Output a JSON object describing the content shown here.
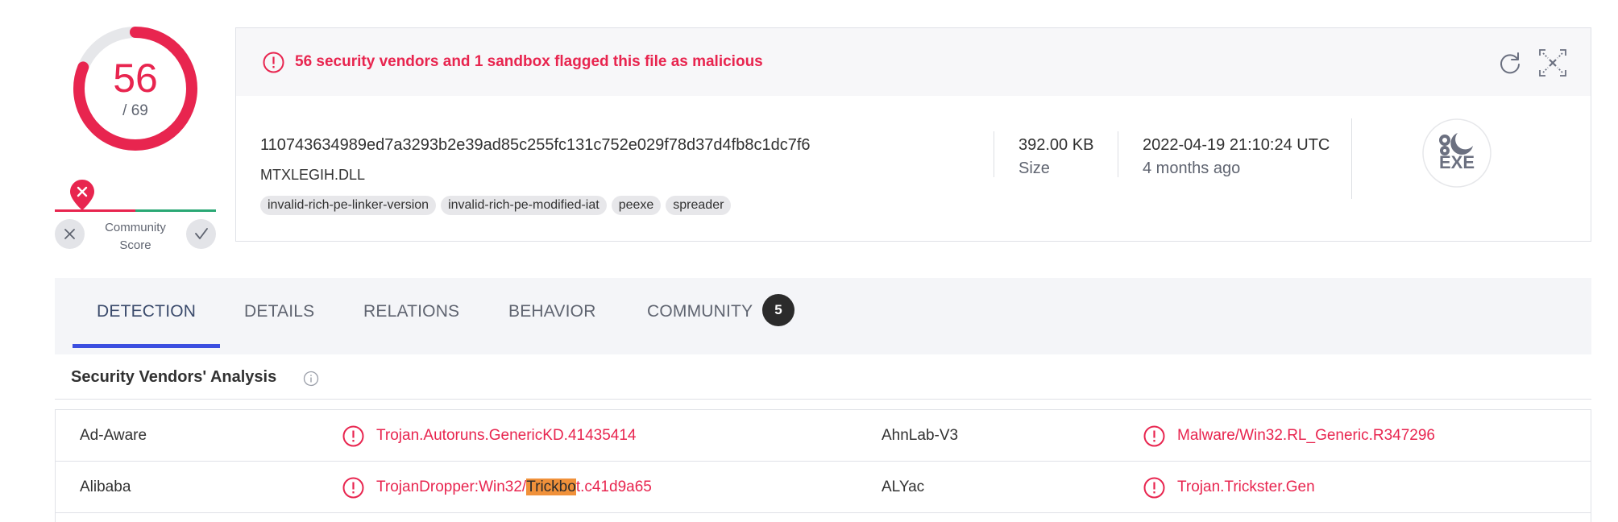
{
  "score": {
    "detections": "56",
    "total": "/ 69",
    "ratio": 0.8116
  },
  "community": {
    "label_line1": "Community",
    "label_line2": "Score",
    "negative_icon": "close-icon",
    "positive_icon": "check-icon"
  },
  "summary": {
    "alert": "56 security vendors and 1 sandbox flagged this file as malicious",
    "hash": "110743634989ed7a3293b2e39ad85c255fc131c752e029f78d37d4fb8c1dc7f6",
    "filename": "MTXLEGIH.DLL",
    "tags": [
      "invalid-rich-pe-linker-version",
      "invalid-rich-pe-modified-iat",
      "peexe",
      "spreader"
    ],
    "size_value": "392.00 KB",
    "size_label": "Size",
    "date_value": "2022-04-19 21:10:24 UTC",
    "date_label": "4 months ago",
    "file_type": "EXE"
  },
  "tabs": {
    "detection": "DETECTION",
    "details": "DETAILS",
    "relations": "RELATIONS",
    "behavior": "BEHAVIOR",
    "community": "COMMUNITY",
    "community_count": "5"
  },
  "section": {
    "title": "Security Vendors' Analysis"
  },
  "vendors": [
    {
      "left_name": "Ad-Aware",
      "left_result": "Trojan.Autoruns.GenericKD.41435414",
      "right_name": "AhnLab-V3",
      "right_result": "Malware/Win32.RL_Generic.R347296"
    },
    {
      "left_name": "Alibaba",
      "left_result_pre": "TrojanDropper:Win32/",
      "left_result_hl": "Trickbo",
      "left_result_post": "t.c41d9a65",
      "right_name": "ALYac",
      "right_result": "Trojan.Trickster.Gen"
    }
  ],
  "colors": {
    "malicious": "#e8254f",
    "harmless": "#2aa875",
    "accent": "#3c4fe0",
    "highlight": "#f0913a"
  }
}
